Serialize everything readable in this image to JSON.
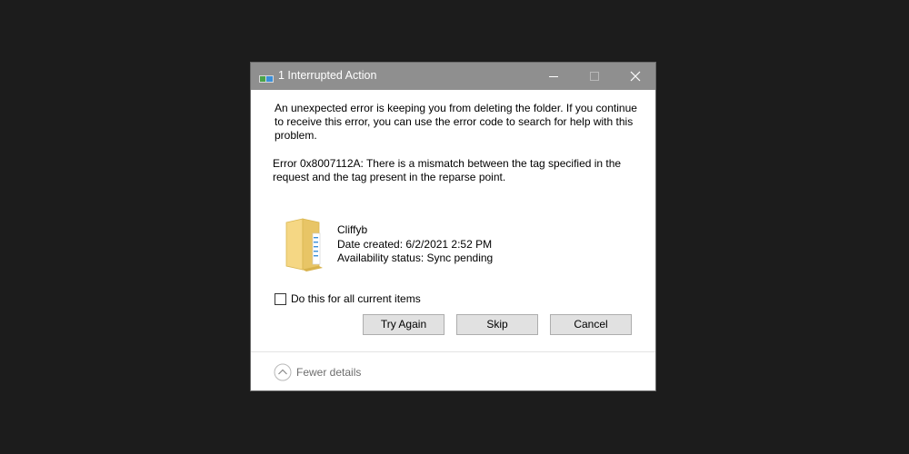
{
  "window": {
    "title": "1 Interrupted Action"
  },
  "content": {
    "message": "An unexpected error is keeping you from deleting the folder. If you continue to receive this error, you can use the error code to search for help with this problem.",
    "error": "Error 0x8007112A: There is a mismatch between the tag specified in the request and the tag present in the reparse point.",
    "file": {
      "name": "Cliffyb",
      "date_created": "Date created: 6/2/2021 2:52 PM",
      "availability": "Availability status: Sync pending"
    },
    "checkbox": {
      "label": "Do this for all current items",
      "checked": false
    }
  },
  "buttons": {
    "try_again": "Try Again",
    "skip": "Skip",
    "cancel": "Cancel"
  },
  "footer": {
    "details_label": "Fewer details"
  },
  "colors": {
    "titlebar": "#8f8f8f",
    "background": "#1c1c1c",
    "button": "#e1e1e1"
  },
  "icons": {
    "title": "file-transfer-icon",
    "minimize": "minimize-icon",
    "maximize": "maximize-icon",
    "close": "close-icon",
    "folder": "folder-icon",
    "details": "chevron-up-circle-icon"
  }
}
